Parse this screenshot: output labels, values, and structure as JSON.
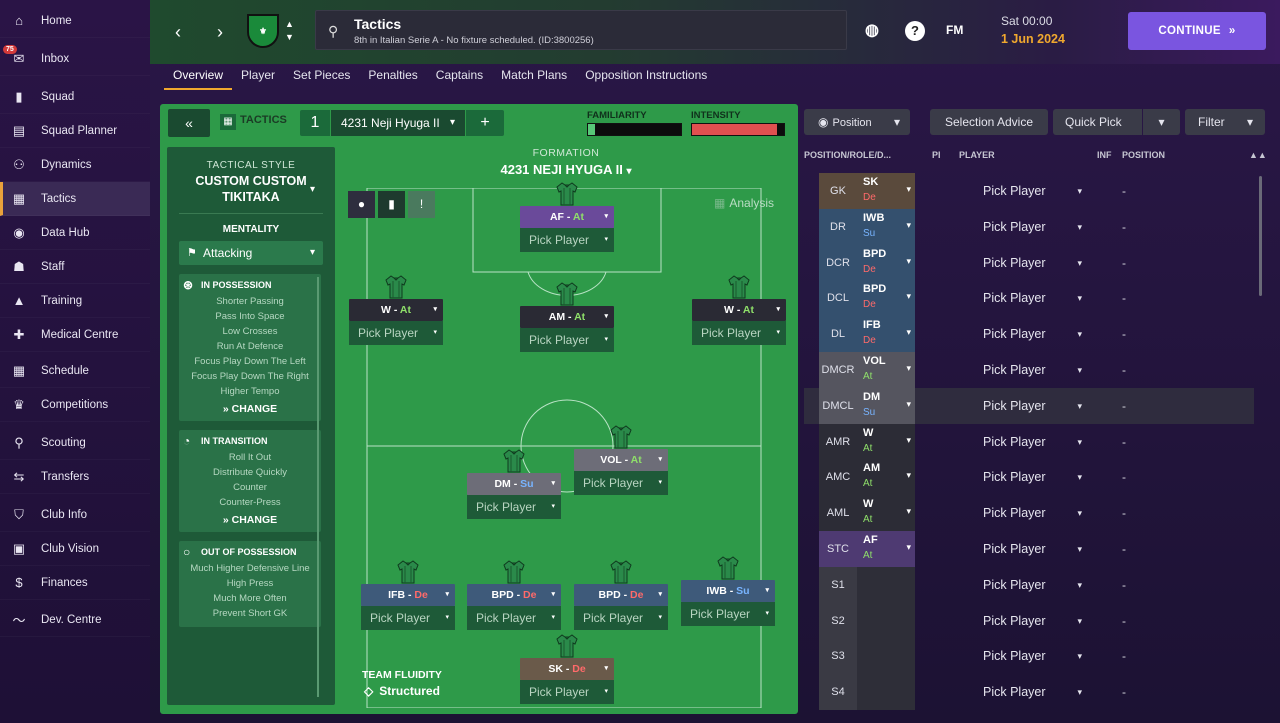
{
  "sidebar": {
    "items": [
      {
        "label": "Home",
        "icon": "home-icon",
        "glyph": "⌂"
      },
      {
        "label": "Inbox",
        "icon": "inbox-icon",
        "glyph": "✉",
        "badge": "75"
      },
      {
        "label": "Squad",
        "icon": "shirt-icon",
        "glyph": "▮"
      },
      {
        "label": "Squad Planner",
        "icon": "clipboard-icon",
        "glyph": "▤"
      },
      {
        "label": "Dynamics",
        "icon": "dynamics-icon",
        "glyph": "⚇"
      },
      {
        "label": "Tactics",
        "icon": "tactics-icon",
        "glyph": "▦"
      },
      {
        "label": "Data Hub",
        "icon": "data-hub-icon",
        "glyph": "◉"
      },
      {
        "label": "Staff",
        "icon": "staff-icon",
        "glyph": "☗"
      },
      {
        "label": "Training",
        "icon": "training-icon",
        "glyph": "▲"
      },
      {
        "label": "Medical Centre",
        "icon": "medical-icon",
        "glyph": "✚"
      },
      {
        "label": "Schedule",
        "icon": "calendar-icon",
        "glyph": "▦"
      },
      {
        "label": "Competitions",
        "icon": "trophy-icon",
        "glyph": "♛"
      },
      {
        "label": "Scouting",
        "icon": "scouting-icon",
        "glyph": "⚲"
      },
      {
        "label": "Transfers",
        "icon": "transfers-icon",
        "glyph": "⇆"
      },
      {
        "label": "Club Info",
        "icon": "shield-icon",
        "glyph": "⛉"
      },
      {
        "label": "Club Vision",
        "icon": "briefcase-icon",
        "glyph": "▣"
      },
      {
        "label": "Finances",
        "icon": "finances-icon",
        "glyph": "$"
      },
      {
        "label": "Dev. Centre",
        "icon": "dev-centre-icon",
        "glyph": "〜"
      }
    ]
  },
  "header": {
    "title": "Tactics",
    "subtitle": "8th in Italian Serie A - No fixture scheduled. (ID:3800256)",
    "fm_label": "FM",
    "date_day": "Sat 00:00",
    "date": "1 Jun 2024",
    "continue_label": "CONTINUE"
  },
  "tabs": [
    "Overview",
    "Player",
    "Set Pieces",
    "Penalties",
    "Captains",
    "Match Plans",
    "Opposition Instructions"
  ],
  "tactic_bar": {
    "label": "TACTICS",
    "slot": "1",
    "name": "4231 Neji Hyuga II",
    "familiarity_label": "FAMILIARITY",
    "intensity_label": "INTENSITY",
    "familiarity_level": 0.08,
    "intensity_level": 0.92
  },
  "style": {
    "heading": "TACTICAL STYLE",
    "name": "CUSTOM CUSTOM TIKITAKA",
    "mentality_label": "MENTALITY",
    "mentality": "Attacking",
    "in_possession_title": "IN POSSESSION",
    "in_possession": [
      "Shorter Passing",
      "Pass Into Space",
      "Low Crosses",
      "Run At Defence",
      "Focus Play Down The Left",
      "Focus Play Down The Right",
      "Higher Tempo"
    ],
    "in_transition_title": "IN TRANSITION",
    "in_transition": [
      "Roll It Out",
      "Distribute Quickly",
      "Counter",
      "Counter-Press"
    ],
    "out_possession_title": "OUT OF POSSESSION",
    "out_possession": [
      "Much Higher Defensive Line",
      "High Press",
      "Much More Often",
      "Prevent Short GK"
    ],
    "change_label": "CHANGE"
  },
  "pitch": {
    "formation_label": "FORMATION",
    "formation_name": "4231 NEJI HYUGA II",
    "analysis_label": "Analysis",
    "fluidity_label": "TEAM FLUIDITY",
    "fluidity_value": "Structured",
    "pick_label": "Pick Player",
    "players": [
      {
        "role": "AF",
        "duty": "At",
        "duty_class": "at",
        "color": "#6a4a9a"
      },
      {
        "role": "W",
        "duty": "At",
        "duty_class": "at",
        "color": "#2a2a34"
      },
      {
        "role": "AM",
        "duty": "At",
        "duty_class": "at",
        "color": "#2a2a34"
      },
      {
        "role": "W",
        "duty": "At",
        "duty_class": "at",
        "color": "#2a2a34"
      },
      {
        "role": "VOL",
        "duty": "At",
        "duty_class": "at",
        "color": "#6d6d78"
      },
      {
        "role": "DM",
        "duty": "Su",
        "duty_class": "su",
        "color": "#6d6d78"
      },
      {
        "role": "IFB",
        "duty": "De",
        "duty_class": "de",
        "color": "#3e5a7a"
      },
      {
        "role": "BPD",
        "duty": "De",
        "duty_class": "de",
        "color": "#3e5a7a"
      },
      {
        "role": "BPD",
        "duty": "De",
        "duty_class": "de",
        "color": "#3e5a7a"
      },
      {
        "role": "IWB",
        "duty": "Su",
        "duty_class": "su",
        "color": "#3e5a7a"
      },
      {
        "role": "SK",
        "duty": "De",
        "duty_class": "de",
        "color": "#6a5a4a"
      }
    ]
  },
  "right": {
    "position_btn": "Position",
    "selection_advice": "Selection Advice",
    "quick_pick": "Quick Pick",
    "filter": "Filter",
    "col_pos": "POSITION/ROLE/D...",
    "col_pi": "PI",
    "col_player": "PLAYER",
    "col_inf": "INF",
    "col_position": "POSITION",
    "pick_label": "Pick Player",
    "dash": "-",
    "rows": [
      {
        "pos": "GK",
        "role": "SK",
        "duty": "De",
        "duty_class": "de",
        "bg": "#5a4a3c"
      },
      {
        "pos": "DR",
        "role": "IWB",
        "duty": "Su",
        "duty_class": "su",
        "bg": "#34506e"
      },
      {
        "pos": "DCR",
        "role": "BPD",
        "duty": "De",
        "duty_class": "de",
        "bg": "#34506e"
      },
      {
        "pos": "DCL",
        "role": "BPD",
        "duty": "De",
        "duty_class": "de",
        "bg": "#34506e"
      },
      {
        "pos": "DL",
        "role": "IFB",
        "duty": "De",
        "duty_class": "de",
        "bg": "#34506e"
      },
      {
        "pos": "DMCR",
        "role": "VOL",
        "duty": "At",
        "duty_class": "at",
        "bg": "#55555f"
      },
      {
        "pos": "DMCL",
        "role": "DM",
        "duty": "Su",
        "duty_class": "su",
        "bg": "#55555f"
      },
      {
        "pos": "AMR",
        "role": "W",
        "duty": "At",
        "duty_class": "at",
        "bg": "#2c2c36"
      },
      {
        "pos": "AMC",
        "role": "AM",
        "duty": "At",
        "duty_class": "at",
        "bg": "#2c2c36"
      },
      {
        "pos": "AML",
        "role": "W",
        "duty": "At",
        "duty_class": "at",
        "bg": "#2c2c36"
      },
      {
        "pos": "STC",
        "role": "AF",
        "duty": "At",
        "duty_class": "at",
        "bg": "#4e3a72"
      },
      {
        "pos": "S1",
        "role": "",
        "duty": "",
        "duty_class": "",
        "bg": "#3a3a44"
      },
      {
        "pos": "S2",
        "role": "",
        "duty": "",
        "duty_class": "",
        "bg": "#3a3a44"
      },
      {
        "pos": "S3",
        "role": "",
        "duty": "",
        "duty_class": "",
        "bg": "#3a3a44"
      },
      {
        "pos": "S4",
        "role": "",
        "duty": "",
        "duty_class": "",
        "bg": "#3a3a44"
      }
    ]
  }
}
